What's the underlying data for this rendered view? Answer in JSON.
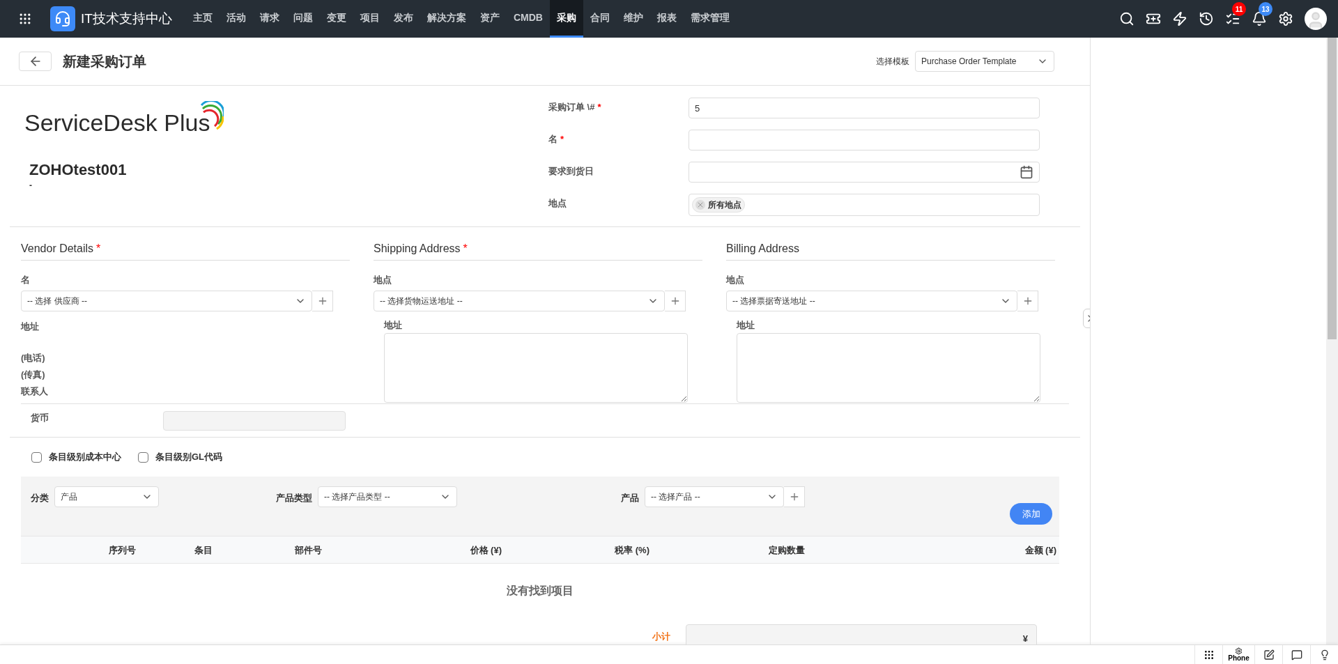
{
  "nav": {
    "app_title": "IT技术支持中心",
    "items": [
      {
        "label": "主页",
        "selected": false
      },
      {
        "label": "活动",
        "selected": false
      },
      {
        "label": "请求",
        "selected": false
      },
      {
        "label": "问题",
        "selected": false
      },
      {
        "label": "变更",
        "selected": false
      },
      {
        "label": "项目",
        "selected": false
      },
      {
        "label": "发布",
        "selected": false
      },
      {
        "label": "解决方案",
        "selected": false
      },
      {
        "label": "资产",
        "selected": false
      },
      {
        "label": "CMDB",
        "selected": false
      },
      {
        "label": "采购",
        "selected": true
      },
      {
        "label": "合同",
        "selected": false
      },
      {
        "label": "维护",
        "selected": false
      },
      {
        "label": "报表",
        "selected": false
      },
      {
        "label": "需求管理",
        "selected": false
      }
    ],
    "task_badge": "11",
    "notification_badge": "13"
  },
  "header": {
    "title": "新建采购订单",
    "template_label": "选择模板",
    "template_value": "Purchase Order Template"
  },
  "logo_text": "ServiceDesk Plus",
  "required_mark": "*",
  "org": {
    "name": "ZOHOtest001",
    "line": "-"
  },
  "fields": [
    {
      "label": "采购订单 \\#",
      "required": true,
      "kind": "text",
      "value": "5"
    },
    {
      "label": "名",
      "required": true,
      "kind": "text"
    },
    {
      "label": "要求到货日",
      "required": false,
      "kind": "date"
    },
    {
      "label": "地点",
      "required": false,
      "kind": "tags",
      "tags": [
        "所有地点"
      ]
    }
  ],
  "sections": [
    {
      "kind": "vendor",
      "title": "Vendor Details",
      "required": true,
      "select_label": "名",
      "select_placeholder": "-- 选择 供应商 --",
      "address_label": "地址",
      "contact_lines": [
        "(电话)",
        "(传真)",
        "联系人"
      ]
    },
    {
      "kind": "address",
      "title": "Shipping Address",
      "required": true,
      "select_label": "地点",
      "select_placeholder": "-- 选择货物运送地址 --",
      "address_label": "地址"
    },
    {
      "kind": "address",
      "title": "Billing Address",
      "required": false,
      "select_label": "地点",
      "select_placeholder": "-- 选择票据寄送地址 --",
      "address_label": "地址"
    }
  ],
  "currency": {
    "label": "货币"
  },
  "checkboxes": [
    {
      "label": "条目级别成本中心",
      "checked": false
    },
    {
      "label": "条目级别GL代码",
      "checked": false
    }
  ],
  "item_filters": {
    "category_label": "分类",
    "category_value": "产品",
    "type_label": "产品类型",
    "type_placeholder": "-- 选择产品类型 --",
    "product_label": "产品",
    "product_placeholder": "-- 选择产品 --",
    "add_button": "添加"
  },
  "table": {
    "columns": [
      "序列号",
      "条目",
      "部件号",
      "价格 (¥)",
      "税率 (%)",
      "定购数量",
      "金额 (¥)"
    ],
    "empty_text": "没有找到项目"
  },
  "subtotal": {
    "label": "小计",
    "currency_symbol": "¥"
  },
  "bottom_bar": {
    "phone_label": "Phone"
  }
}
